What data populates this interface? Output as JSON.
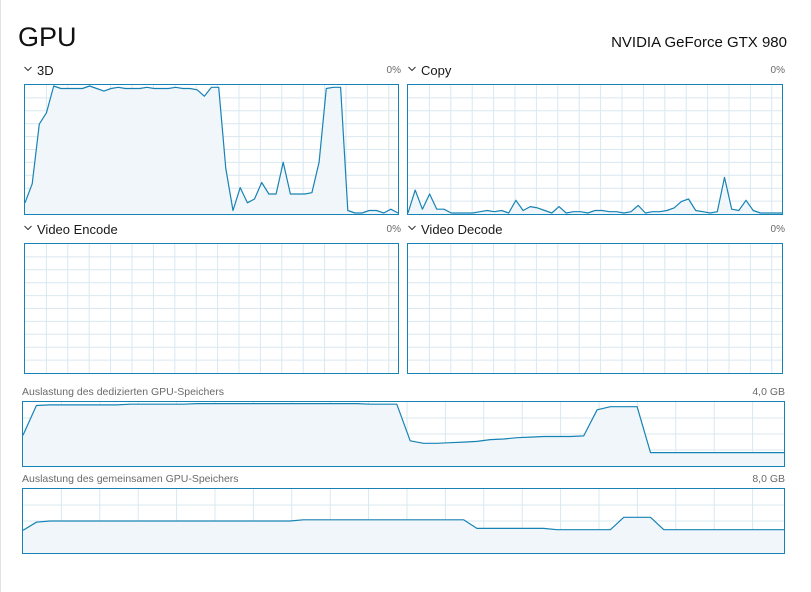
{
  "header": {
    "title": "GPU",
    "gpu_name": "NVIDIA GeForce GTX 980"
  },
  "colors": {
    "accent": "#1783b5",
    "fill": "#f1f6fa",
    "grid": "#d9e8f1",
    "text_secondary": "#6a6a6a"
  },
  "engines": [
    {
      "label": "3D",
      "value": "0%",
      "history": [
        8,
        23,
        70,
        79,
        100,
        98,
        98,
        98,
        98,
        100,
        98,
        96,
        98,
        99,
        98,
        98,
        98,
        99,
        98,
        98,
        98,
        99,
        98,
        98,
        97,
        92,
        99,
        99,
        35,
        2,
        20,
        8,
        11,
        24,
        15,
        15,
        40,
        15,
        15,
        15,
        16,
        40,
        98,
        99,
        99,
        2,
        0,
        0,
        2,
        2,
        0,
        3,
        0
      ]
    },
    {
      "label": "Copy",
      "value": "0%",
      "history": [
        0,
        18,
        3,
        15,
        3,
        3,
        0,
        0,
        0,
        0,
        1,
        2,
        1,
        2,
        0,
        10,
        2,
        5,
        4,
        2,
        0,
        5,
        0,
        1,
        1,
        0,
        2,
        2,
        1,
        1,
        0,
        1,
        6,
        0,
        1,
        1,
        2,
        4,
        9,
        11,
        2,
        1,
        0,
        1,
        28,
        3,
        2,
        10,
        2,
        0,
        0,
        0,
        0
      ]
    },
    {
      "label": "Video Encode",
      "value": "0%",
      "history": []
    },
    {
      "label": "Video Decode",
      "value": "0%",
      "history": []
    }
  ],
  "memory": [
    {
      "label": "Auslastung des dedizierten GPU-Speichers",
      "value": "4,0 GB",
      "history": [
        48,
        96,
        97,
        97,
        97,
        97,
        97,
        97,
        98,
        98,
        98,
        98,
        98,
        99,
        99,
        99,
        99,
        99,
        99,
        99,
        99,
        99,
        99,
        99,
        99,
        99,
        98,
        98,
        98,
        39,
        35,
        35,
        36,
        37,
        38,
        41,
        42,
        44,
        45,
        46,
        46,
        46,
        47,
        89,
        94,
        94,
        94,
        20,
        20,
        20,
        20,
        20,
        20,
        20,
        20,
        20,
        20,
        20
      ]
    },
    {
      "label": "Auslastung des gemeinsamen GPU-Speichers",
      "value": "8,0 GB",
      "history": [
        35,
        48,
        50,
        50,
        50,
        50,
        50,
        50,
        50,
        50,
        50,
        50,
        50,
        50,
        50,
        50,
        50,
        50,
        50,
        50,
        50,
        52,
        52,
        52,
        52,
        52,
        52,
        52,
        52,
        52,
        52,
        52,
        52,
        52,
        38,
        38,
        38,
        38,
        38,
        38,
        36,
        36,
        36,
        36,
        36,
        56,
        56,
        56,
        36,
        36,
        36,
        36,
        36,
        36,
        36,
        36,
        36,
        36
      ]
    }
  ]
}
